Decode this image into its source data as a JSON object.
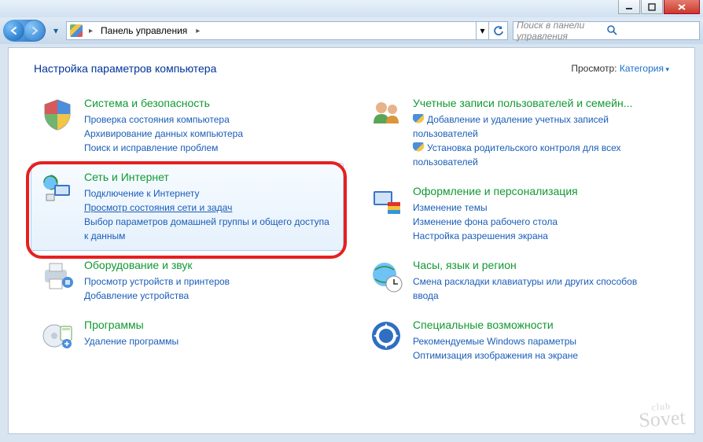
{
  "breadcrumb": {
    "root": "Панель управления"
  },
  "search": {
    "placeholder": "Поиск в панели управления"
  },
  "heading": "Настройка параметров компьютера",
  "view": {
    "label": "Просмотр:",
    "value": "Категория"
  },
  "left": [
    {
      "title": "Система и безопасность",
      "links": [
        "Проверка состояния компьютера",
        "Архивирование данных компьютера",
        "Поиск и исправление проблем"
      ]
    },
    {
      "title": "Сеть и Интернет",
      "links": [
        "Подключение к Интернету",
        "Просмотр состояния сети и задач",
        "Выбор параметров домашней группы и общего доступа к данным"
      ]
    },
    {
      "title": "Оборудование и звук",
      "links": [
        "Просмотр устройств и принтеров",
        "Добавление устройства"
      ]
    },
    {
      "title": "Программы",
      "links": [
        "Удаление программы"
      ]
    }
  ],
  "right": [
    {
      "title": "Учетные записи пользователей и семейн...",
      "shield_links": [
        "Добавление и удаление учетных записей пользователей",
        "Установка родительского контроля для всех пользователей"
      ]
    },
    {
      "title": "Оформление и персонализация",
      "links": [
        "Изменение темы",
        "Изменение фона рабочего стола",
        "Настройка разрешения экрана"
      ]
    },
    {
      "title": "Часы, язык и регион",
      "links": [
        "Смена раскладки клавиатуры или других способов ввода"
      ]
    },
    {
      "title": "Специальные возможности",
      "links": [
        "Рекомендуемые Windows параметры",
        "Оптимизация изображения на экране"
      ]
    }
  ],
  "watermark": {
    "top": "club",
    "bottom": "Sovet"
  }
}
